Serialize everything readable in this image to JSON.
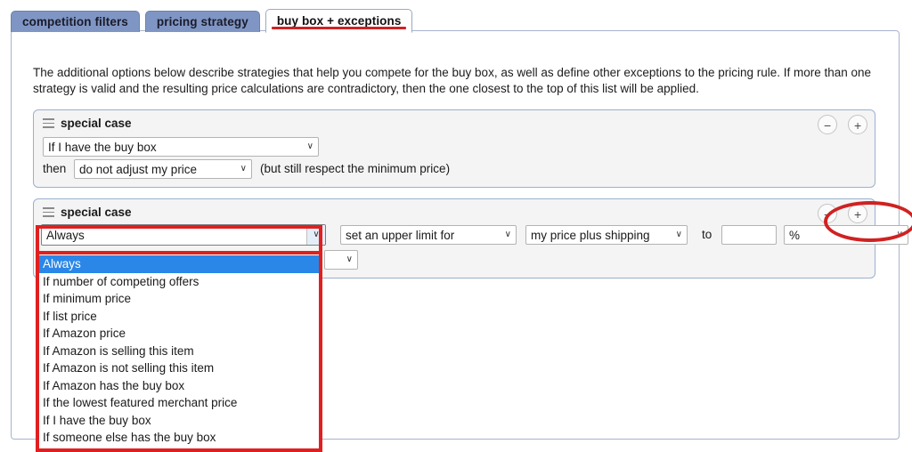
{
  "tabs": [
    {
      "label": "competition filters",
      "active": false
    },
    {
      "label": "pricing strategy",
      "active": false
    },
    {
      "label": "buy box + exceptions",
      "active": true
    }
  ],
  "intro": {
    "text": "The additional options below describe strategies that help you compete for the buy box, as well as define other exceptions to the pricing rule. If more than one strategy is valid and the resulting price calculations are contradictory, then the one closest to the top of this list will be applied."
  },
  "case1": {
    "title": "special case",
    "menu_icon": "hamburger-icon",
    "condition_value": "If I have the buy box",
    "then_label": "then",
    "action_value": "do not adjust my price",
    "note": "(but still respect the minimum price)",
    "remove_label": "−",
    "add_label": "+"
  },
  "case2": {
    "title": "special case",
    "menu_icon": "hamburger-icon",
    "condition_value": "Always",
    "limit_value": "set an upper limit for",
    "basis_value": "my price plus shipping",
    "to_label": "to",
    "amount_value": "",
    "unit_value": "%",
    "second_row_value": "",
    "remove_label": "−",
    "add_label": "+"
  },
  "dropdown": {
    "open": true,
    "selected_index": 0,
    "options": [
      "Always",
      "If number of competing offers",
      "If minimum price",
      "If list price",
      "If Amazon price",
      "If Amazon is selling this item",
      "If Amazon is not selling this item",
      "If Amazon has the buy box",
      "If the lowest featured merchant price",
      "If I have the buy box",
      "If someone else has the buy box"
    ]
  },
  "annotations": {
    "highlight_color": "#e02020",
    "ellipse_color": "#cf2222",
    "active_tab_underline_color": "#cf2222"
  },
  "caret_glyph": "∨"
}
